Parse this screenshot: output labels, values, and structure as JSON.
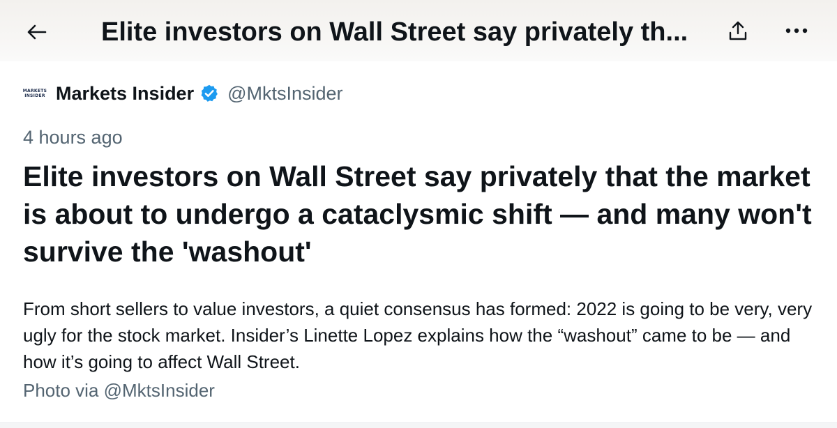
{
  "header": {
    "title": "Elite investors on Wall Street say privately th...",
    "back_icon": "arrow-left-icon",
    "share_icon": "share-icon",
    "more_icon": "more-horizontal-icon"
  },
  "author": {
    "avatar_text_line1": "MARKETS",
    "avatar_text_line2": "INSIDER",
    "name": "Markets Insider",
    "verified_icon": "verified-badge-icon",
    "handle": "@MktsInsider"
  },
  "post": {
    "timestamp": "4 hours ago",
    "headline": "Elite investors on Wall Street say privately that the market is about to undergo a cataclysmic shift — and many won't survive the 'washout'",
    "description": "From short sellers to value investors, a quiet consensus has formed: 2022 is going to be very, very ugly for the stock market. Insider’s Linette Lopez explains how the “washout” came to be — and how it’s going to affect Wall Street.",
    "photo_credit": "Photo via @MktsInsider"
  },
  "colors": {
    "text_primary": "#0f1419",
    "text_secondary": "#536471",
    "verified_blue": "#1d9bf0"
  }
}
